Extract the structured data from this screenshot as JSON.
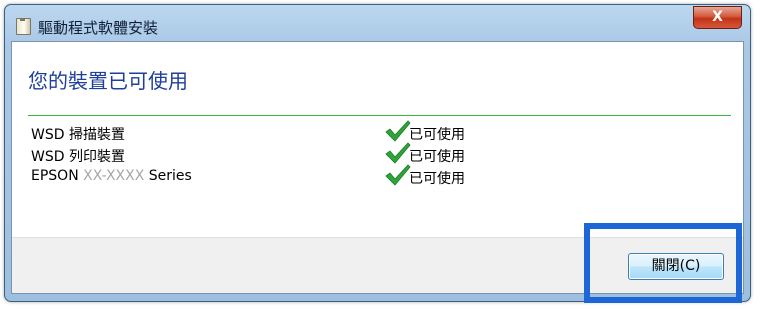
{
  "window": {
    "title": "驅動程式軟體安裝",
    "close_label": "X"
  },
  "main": {
    "heading": "您的裝置已可使用",
    "devices": [
      {
        "name": "WSD 掃描裝置",
        "name_blur": "",
        "name_suffix": "",
        "status": "已可使用"
      },
      {
        "name": "WSD 列印裝置",
        "name_blur": "",
        "name_suffix": "",
        "status": "已可使用"
      },
      {
        "name": "EPSON",
        "name_blur": " XX-XXXX ",
        "name_suffix": "Series",
        "status": "已可使用"
      }
    ]
  },
  "footer": {
    "close_button_label": "關閉(C)"
  },
  "colors": {
    "heading": "#1f3f9a",
    "divider": "#3cb43c",
    "check": "#2ea53a",
    "highlight": "#1c66d6"
  }
}
